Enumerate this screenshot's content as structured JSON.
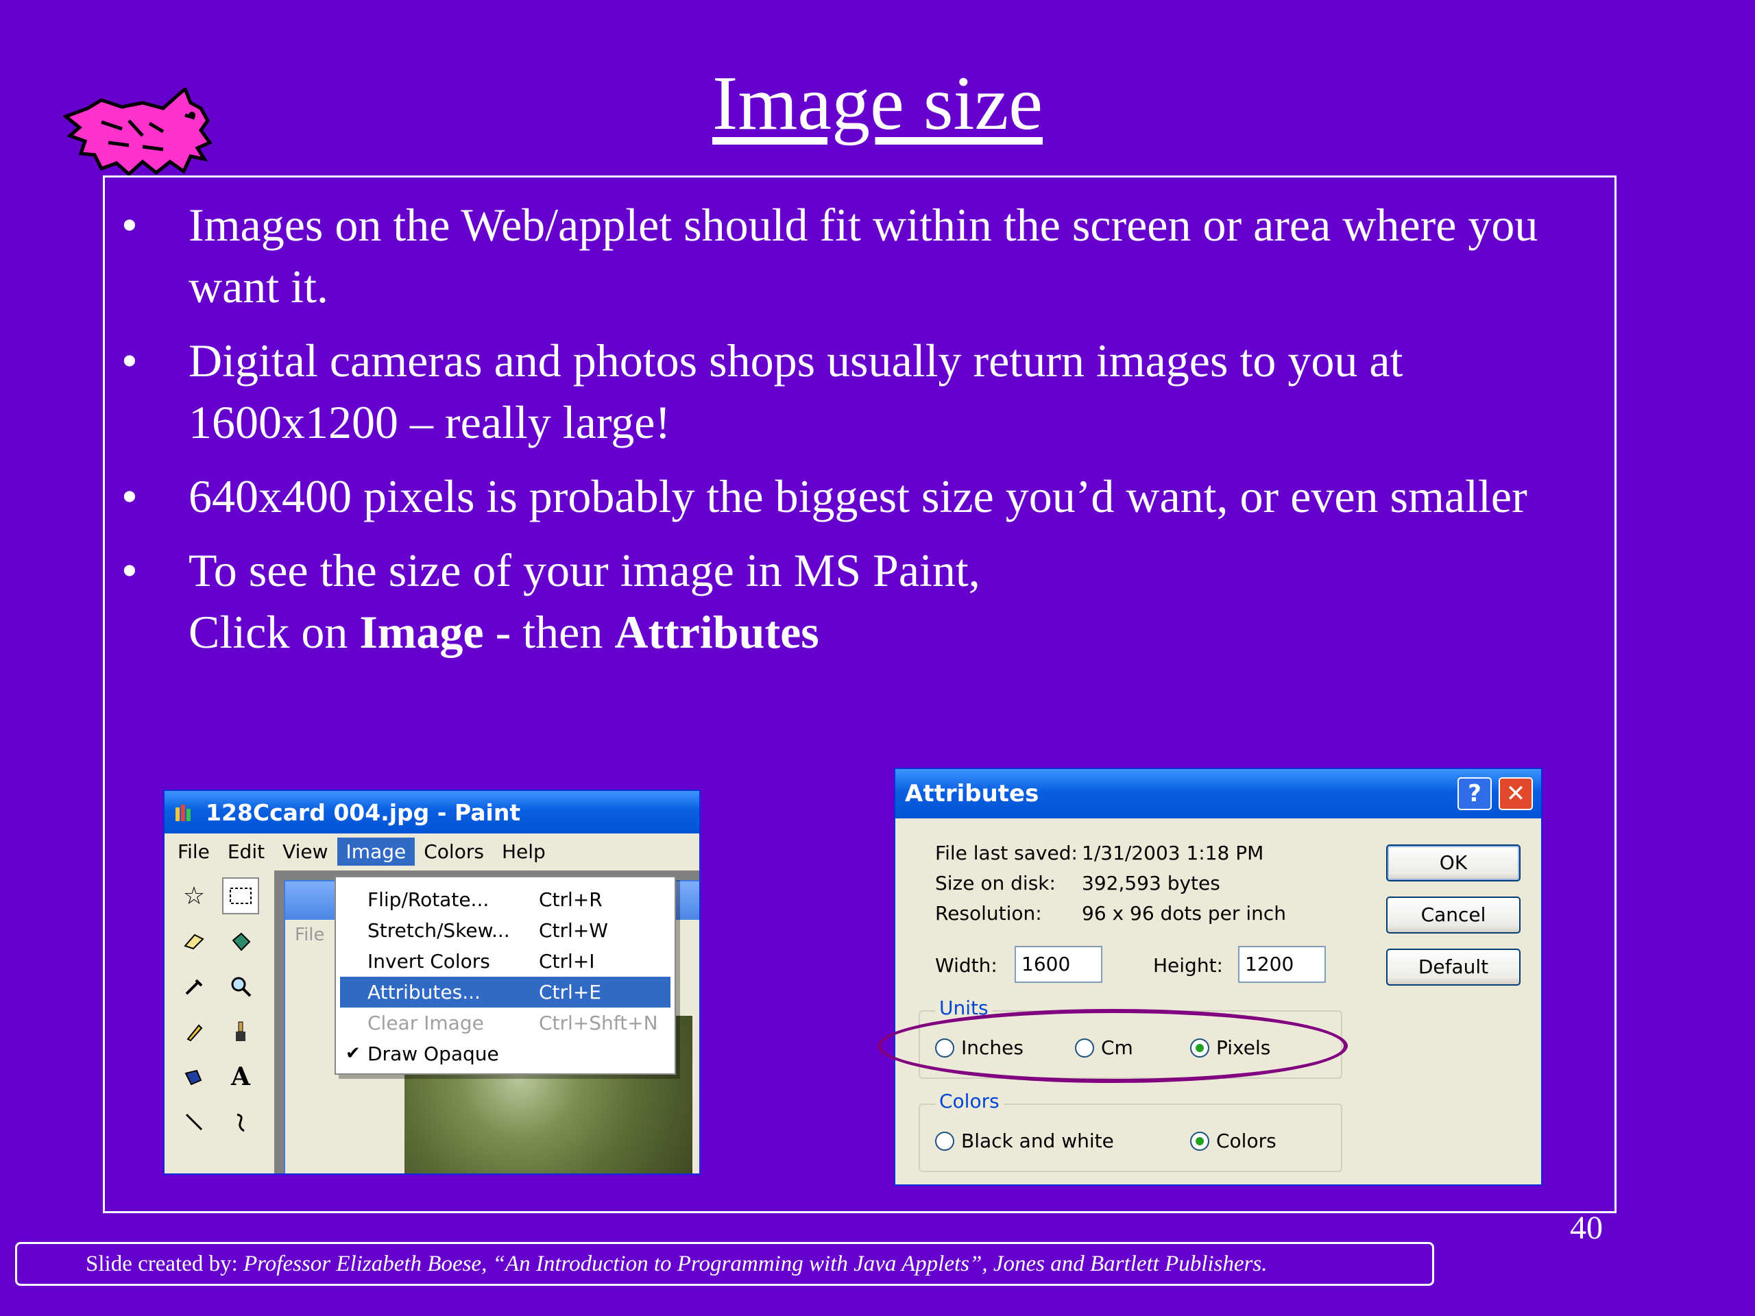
{
  "slide": {
    "title": "Image size",
    "bullet_symbol": "•",
    "bullets": [
      "Images on the Web/applet should fit within the screen or area where you want it.",
      "Digital cameras and photos shops usually return images to you at 1600x1200 – really large!",
      "640x400 pixels is probably the biggest size you’d want, or even smaller"
    ],
    "bullet4": {
      "line1": "To see the size of your image in MS Paint,",
      "prefix": "Click on ",
      "image_word": "Image",
      "middle": " - then ",
      "attributes_word": "Attributes"
    },
    "page_number": "40",
    "footer": {
      "prefix": "Slide created by: ",
      "citation": "Professor Elizabeth Boese, “An Introduction to Programming with Java Applets”, Jones and Bartlett Publishers."
    }
  },
  "paint_window": {
    "title": "128Ccard 004.jpg - Paint",
    "menus": [
      "File",
      "Edit",
      "View",
      "Image",
      "Colors",
      "Help"
    ],
    "active_menu": "Image",
    "inner_menu": "File",
    "menu_items": [
      {
        "label": "Flip/Rotate...",
        "shortcut": "Ctrl+R"
      },
      {
        "label": "Stretch/Skew...",
        "shortcut": "Ctrl+W"
      },
      {
        "label": "Invert Colors",
        "shortcut": "Ctrl+I"
      },
      {
        "label": "Attributes...",
        "shortcut": "Ctrl+E",
        "highlighted": true
      },
      {
        "label": "Clear Image",
        "shortcut": "Ctrl+Shft+N",
        "disabled": true
      },
      {
        "label": "Draw Opaque",
        "shortcut": "",
        "checked": true
      }
    ],
    "check_glyph": "✔"
  },
  "attributes_dialog": {
    "title": "Attributes",
    "help_glyph": "?",
    "close_glyph": "✕",
    "file_last_saved_label": "File last saved:",
    "file_last_saved_value": "1/31/2003 1:18 PM",
    "size_on_disk_label": "Size on disk:",
    "size_on_disk_value": "392,593 bytes",
    "resolution_label": "Resolution:",
    "resolution_value": "96 x 96 dots per inch",
    "width_label": "Width:",
    "width_value": "1600",
    "height_label": "Height:",
    "height_value": "1200",
    "units_label": "Units",
    "units": [
      {
        "label": "Inches",
        "checked": false
      },
      {
        "label": "Cm",
        "checked": false
      },
      {
        "label": "Pixels",
        "checked": true
      }
    ],
    "colors_label": "Colors",
    "colors": [
      {
        "label": "Black and white",
        "checked": false
      },
      {
        "label": "Colors",
        "checked": true
      }
    ],
    "ok_label": "OK",
    "cancel_label": "Cancel",
    "default_label": "Default"
  },
  "colors": {
    "background": "#6600cc",
    "highlight_ellipse": "#800080",
    "xp_title_blue": "#0a5fe0",
    "menu_highlight": "#316ac5"
  },
  "icons": [
    "mascot-cat",
    "paint-app-icon",
    "check-icon",
    "help-icon",
    "close-icon"
  ]
}
